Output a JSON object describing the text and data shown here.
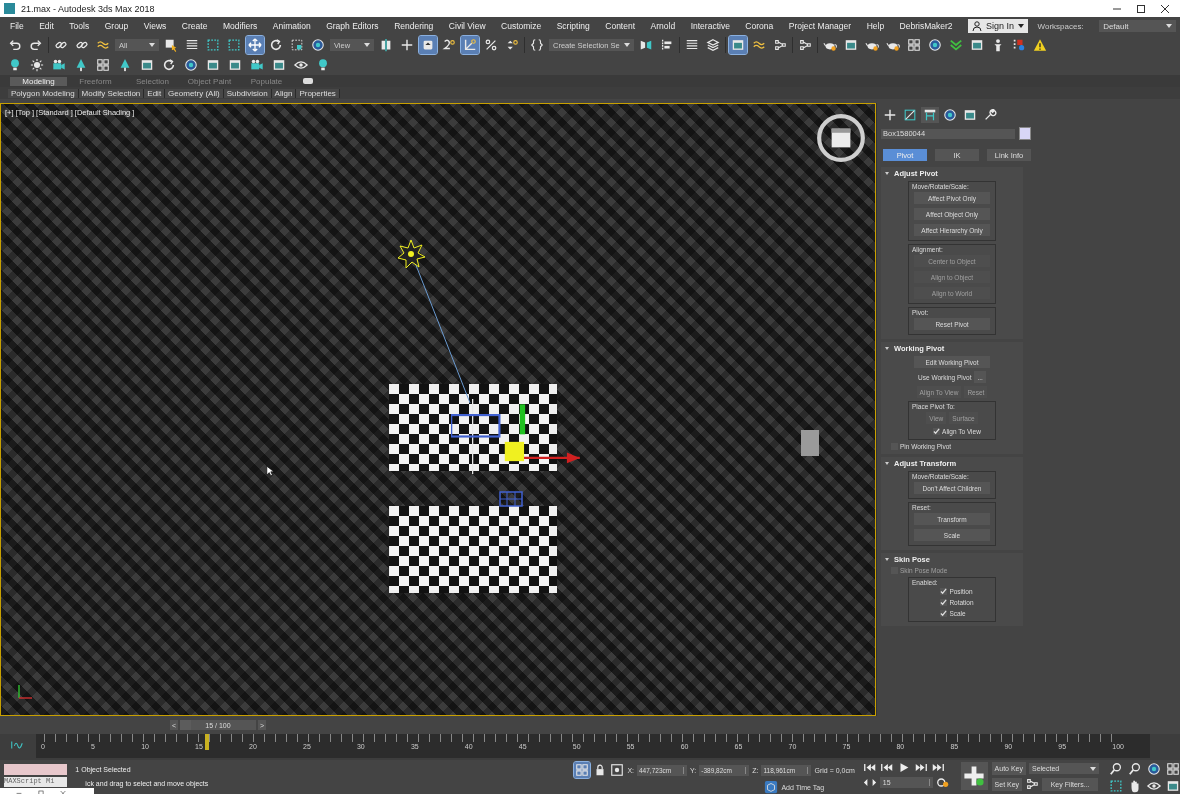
{
  "window": {
    "title": "21.max - Autodesk 3ds Max 2018"
  },
  "menu": [
    "File",
    "Edit",
    "Tools",
    "Group",
    "Views",
    "Create",
    "Modifiers",
    "Animation",
    "Graph Editors",
    "Rendering",
    "Civil View",
    "Customize",
    "Scripting",
    "Content",
    "Arnold",
    "Interactive",
    "Corona",
    "Project Manager",
    "Help",
    "DebrisMaker2"
  ],
  "account": {
    "label": "Sign In"
  },
  "workspaces": {
    "label": "Workspaces:",
    "value": "Default"
  },
  "main_toolbar": [
    {
      "kind": "icon",
      "active": false
    },
    {
      "kind": "icon",
      "active": false
    },
    {
      "kind": "separator"
    },
    {
      "kind": "icon",
      "active": false
    },
    {
      "kind": "icon",
      "active": false
    },
    {
      "kind": "icon",
      "active": false
    },
    {
      "kind": "dropdown",
      "value": "All"
    },
    {
      "kind": "icon",
      "active": false
    },
    {
      "kind": "icon",
      "active": false
    },
    {
      "kind": "icon",
      "active": false
    },
    {
      "kind": "icon",
      "active": false
    },
    {
      "kind": "icon",
      "active": true
    },
    {
      "kind": "icon",
      "active": false
    },
    {
      "kind": "icon",
      "active": false
    },
    {
      "kind": "icon",
      "active": false
    },
    {
      "kind": "dropdown",
      "value": "View"
    },
    {
      "kind": "icon",
      "active": false
    },
    {
      "kind": "icon",
      "active": false
    },
    {
      "kind": "icon",
      "active": true
    },
    {
      "kind": "icon",
      "active": false
    },
    {
      "kind": "icon",
      "active": true
    },
    {
      "kind": "icon",
      "active": false
    },
    {
      "kind": "icon",
      "active": false
    },
    {
      "kind": "separator"
    },
    {
      "kind": "icon",
      "active": false
    },
    {
      "kind": "dropdown",
      "value": "Create Selection Se"
    },
    {
      "kind": "icon",
      "active": false
    },
    {
      "kind": "icon",
      "active": false
    },
    {
      "kind": "separator"
    },
    {
      "kind": "icon",
      "active": false
    },
    {
      "kind": "icon",
      "active": false
    },
    {
      "kind": "separator"
    },
    {
      "kind": "icon",
      "active": true
    },
    {
      "kind": "icon",
      "active": false
    },
    {
      "kind": "icon",
      "active": false
    },
    {
      "kind": "separator"
    },
    {
      "kind": "icon",
      "active": false
    },
    {
      "kind": "separator"
    },
    {
      "kind": "icon",
      "active": false
    },
    {
      "kind": "icon",
      "active": false
    },
    {
      "kind": "icon",
      "active": false
    },
    {
      "kind": "icon",
      "active": false
    },
    {
      "kind": "icon",
      "active": false
    },
    {
      "kind": "icon",
      "active": false
    },
    {
      "kind": "icon",
      "active": false
    },
    {
      "kind": "icon",
      "active": false
    },
    {
      "kind": "icon",
      "active": false
    },
    {
      "kind": "icon",
      "active": false
    },
    {
      "kind": "icon",
      "active": false
    }
  ],
  "ribbon": {
    "tabs": [
      {
        "label": "Modeling",
        "selected": true
      },
      {
        "label": "Freeform",
        "selected": false
      },
      {
        "label": "Selection",
        "selected": false
      },
      {
        "label": "Object Paint",
        "selected": false
      },
      {
        "label": "Populate",
        "selected": false
      }
    ],
    "panels": [
      "Polygon Modeling",
      "Modify Selection",
      "Edit",
      "Geometry (All)",
      "Subdivision",
      "Align",
      "Properties"
    ]
  },
  "viewport": {
    "label": "[+] [Top ] [Standard ] [Default Shading ]",
    "active": true
  },
  "command_panel": {
    "tabs": [
      {
        "selected": false
      },
      {
        "selected": false
      },
      {
        "selected": true
      },
      {
        "selected": false
      },
      {
        "selected": false
      },
      {
        "selected": false
      }
    ],
    "object_name": "Box1580044",
    "subtabs": [
      {
        "label": "Pivot",
        "selected": true
      },
      {
        "label": "IK",
        "selected": false
      },
      {
        "label": "Link Info",
        "selected": false
      }
    ],
    "rollouts": [
      {
        "title": "Adjust Pivot",
        "expanded": true,
        "items": [
          {
            "kind": "group",
            "label": "Move/Rotate/Scale:",
            "items": [
              {
                "kind": "button",
                "label": "Affect Pivot Only",
                "disabled": false
              },
              {
                "kind": "button",
                "label": "Affect Object Only",
                "disabled": false
              },
              {
                "kind": "button",
                "label": "Affect Hierarchy Only",
                "disabled": false
              }
            ]
          },
          {
            "kind": "group",
            "label": "Alignment:",
            "items": [
              {
                "kind": "button",
                "label": "Center to Object",
                "disabled": true
              },
              {
                "kind": "button",
                "label": "Align to Object",
                "disabled": true
              },
              {
                "kind": "button",
                "label": "Align to World",
                "disabled": true
              }
            ]
          },
          {
            "kind": "group",
            "label": "Pivot:",
            "items": [
              {
                "kind": "button",
                "label": "Reset Pivot",
                "disabled": false
              }
            ]
          }
        ]
      },
      {
        "title": "Working Pivot",
        "expanded": true,
        "items": [
          {
            "kind": "button",
            "label": "Edit Working Pivot",
            "disabled": false
          },
          {
            "kind": "row",
            "items": [
              {
                "kind": "text",
                "label": "Use Working Pivot"
              },
              {
                "kind": "button",
                "label": "...",
                "disabled": false
              }
            ]
          },
          {
            "kind": "row",
            "items": [
              {
                "kind": "button",
                "label": "Align To View",
                "disabled": true
              },
              {
                "kind": "button",
                "label": "Reset",
                "disabled": true
              }
            ]
          },
          {
            "kind": "group",
            "label": "Place Pivot To:",
            "items": [
              {
                "kind": "row",
                "items": [
                  {
                    "kind": "button",
                    "label": "View",
                    "disabled": true
                  },
                  {
                    "kind": "button",
                    "label": "Surface",
                    "disabled": true
                  }
                ]
              },
              {
                "kind": "checkbox",
                "label": "Align To View",
                "checked": true,
                "disabled": false
              }
            ]
          },
          {
            "kind": "checkbox",
            "label": "Pin Working Pivot",
            "checked": false,
            "disabled": false
          }
        ]
      },
      {
        "title": "Adjust Transform",
        "expanded": true,
        "items": [
          {
            "kind": "group",
            "label": "Move/Rotate/Scale:",
            "items": [
              {
                "kind": "button",
                "label": "Don't Affect Children",
                "disabled": false
              }
            ]
          },
          {
            "kind": "group",
            "label": "Reset:",
            "items": [
              {
                "kind": "button",
                "label": "Transform",
                "disabled": false
              },
              {
                "kind": "button",
                "label": "Scale",
                "disabled": false
              }
            ]
          }
        ]
      },
      {
        "title": "Skin Pose",
        "expanded": true,
        "items": [
          {
            "kind": "checkbox",
            "label": "Skin Pose Mode",
            "checked": false,
            "disabled": true
          },
          {
            "kind": "group",
            "label": "Enabled:",
            "items": [
              {
                "kind": "checkbox",
                "label": "Position",
                "checked": true,
                "disabled": false
              },
              {
                "kind": "checkbox",
                "label": "Rotation",
                "checked": true,
                "disabled": false
              },
              {
                "kind": "checkbox",
                "label": "Scale",
                "checked": true,
                "disabled": false
              }
            ]
          }
        ]
      }
    ]
  },
  "time_slider": {
    "prev": "<",
    "label": "15 / 100",
    "next": ">",
    "level": 0.15
  },
  "track_bar": {
    "labels": [
      "0",
      "5",
      "10",
      "15",
      "20",
      "25",
      "30",
      "35",
      "40",
      "45",
      "50",
      "55",
      "60",
      "65",
      "70",
      "75",
      "80",
      "85",
      "90",
      "95",
      "100"
    ],
    "level": 0.15
  },
  "status_bar": {
    "listener": "MAXScript Mi",
    "selection": "1 Object Selected",
    "prompt": "ick and drag to select and move objects",
    "coordinates": [
      {
        "axis": "X:",
        "value": "447,723cm"
      },
      {
        "axis": "Y:",
        "value": "-389,82cm"
      },
      {
        "axis": "Z:",
        "value": "118,961cm"
      }
    ],
    "grid": "Grid = 0,0cm",
    "time_tag": "Add Time Tag",
    "frame": "15",
    "auto_key": "Auto Key",
    "set_key": "Set Key",
    "key_mode": "Selected",
    "key_filters": "Key Filters..."
  }
}
